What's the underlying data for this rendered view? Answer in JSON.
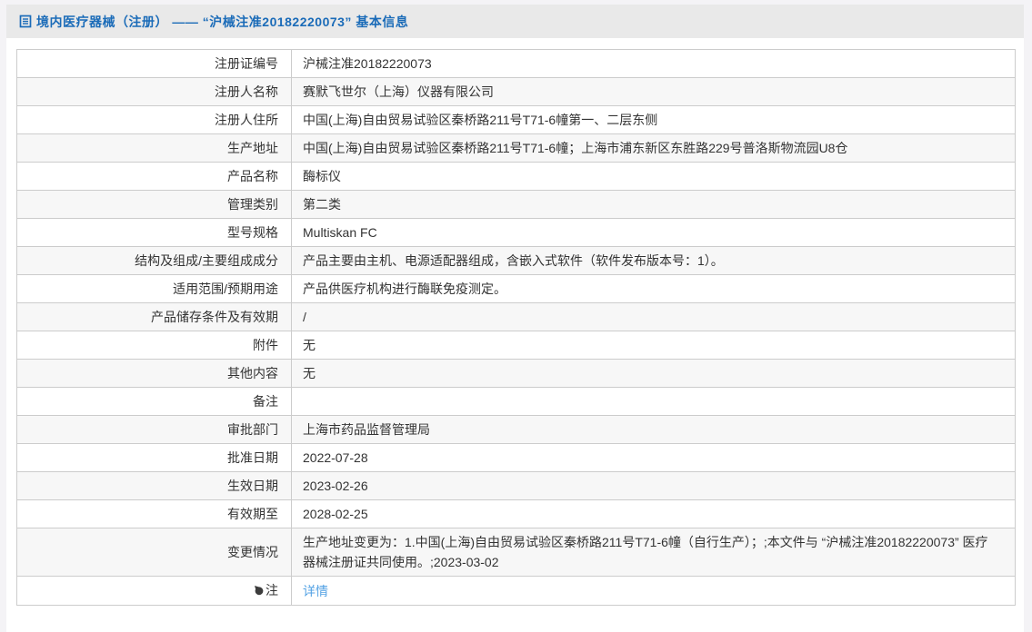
{
  "header": {
    "title": "境内医疗器械（注册） —— “沪械注准20182220073” 基本信息"
  },
  "table": {
    "rows": [
      {
        "label": "注册证编号",
        "value": "沪械注准20182220073"
      },
      {
        "label": "注册人名称",
        "value": "赛默飞世尔（上海）仪器有限公司"
      },
      {
        "label": "注册人住所",
        "value": "中国(上海)自由贸易试验区秦桥路211号T71-6幢第一、二层东侧"
      },
      {
        "label": "生产地址",
        "value": "中国(上海)自由贸易试验区秦桥路211号T71-6幢；上海市浦东新区东胜路229号普洛斯物流园U8仓"
      },
      {
        "label": "产品名称",
        "value": "酶标仪"
      },
      {
        "label": "管理类别",
        "value": "第二类"
      },
      {
        "label": "型号规格",
        "value": "Multiskan FC"
      },
      {
        "label": "结构及组成/主要组成成分",
        "value": "产品主要由主机、电源适配器组成，含嵌入式软件（软件发布版本号：1）。"
      },
      {
        "label": "适用范围/预期用途",
        "value": "产品供医疗机构进行酶联免疫测定。"
      },
      {
        "label": "产品储存条件及有效期",
        "value": "/"
      },
      {
        "label": "附件",
        "value": "无"
      },
      {
        "label": "其他内容",
        "value": "无"
      },
      {
        "label": "备注",
        "value": ""
      },
      {
        "label": "审批部门",
        "value": "上海市药品监督管理局"
      },
      {
        "label": "批准日期",
        "value": "2022-07-28"
      },
      {
        "label": "生效日期",
        "value": "2023-02-26"
      },
      {
        "label": "有效期至",
        "value": "2028-02-25"
      },
      {
        "label": "变更情况",
        "value": "生产地址变更为：1.中国(上海)自由贸易试验区秦桥路211号T71-6幢（自行生产）；;本文件与 “沪械注准20182220073” 医疗器械注册证共同使用。;2023-03-02"
      }
    ],
    "note_row": {
      "label": "注",
      "link_text": "详情"
    }
  },
  "colors": {
    "title_blue": "#1a6bb8",
    "link_blue": "#53a2e4",
    "header_bg": "#e9e9e9",
    "row_alt_bg": "#f7f7f7",
    "border": "#cccccc",
    "page_bg": "#f4f3f6"
  }
}
